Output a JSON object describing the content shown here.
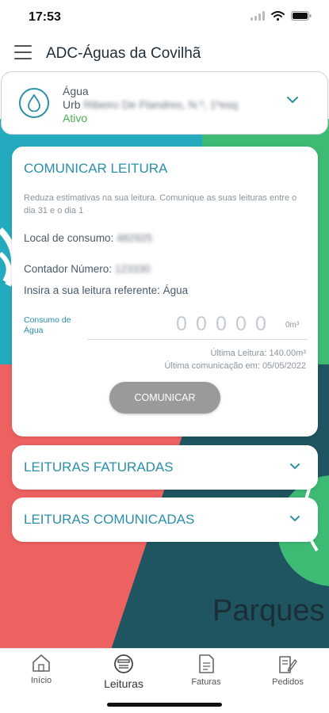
{
  "status_bar": {
    "time": "17:53"
  },
  "header": {
    "title": "ADC-Águas da Covilhã"
  },
  "contract": {
    "type": "Água",
    "address_prefix": "Urb",
    "address_redacted": "Ribeiro De Flandres, N.º, 1ºesq",
    "status": "Ativo",
    "icon": "water-drop-icon"
  },
  "reading_card": {
    "title": "COMUNICAR LEITURA",
    "note": "Reduza estimativas na sua leitura. Comunique as suas leituras entre o dia 31 e o dia 1",
    "local_label": "Local de consumo:",
    "local_value": "482925",
    "meter_label": "Contador Número:",
    "meter_value": "123330",
    "insert_label": "Insira a sua leitura referente:",
    "insert_value": "Água",
    "consumption_label": "Consumo de Água",
    "digits": [
      "0",
      "0",
      "0",
      "0",
      "0"
    ],
    "unit": "0m³",
    "last_reading": "Última Leitura: 140.00m³",
    "last_communication": "Última comunicação em: 05/05/2022",
    "button": "COMUNICAR"
  },
  "accordions": [
    {
      "label": "LEITURAS FATURADAS"
    },
    {
      "label": "LEITURAS COMUNICADAS"
    }
  ],
  "background": {
    "left_text": "o",
    "right_text": "Parques",
    "colors": {
      "teal": "#24aabf",
      "green": "#3dba74",
      "coral": "#ee6161",
      "dark": "#1f5560"
    }
  },
  "tabs": [
    {
      "label": "Início",
      "icon": "home-icon"
    },
    {
      "label": "Leituras",
      "icon": "meter-icon"
    },
    {
      "label": "Faturas",
      "icon": "invoice-icon"
    },
    {
      "label": "Pedidos",
      "icon": "requests-icon"
    }
  ],
  "colors": {
    "accent": "#2a8fa8",
    "active_status": "#4caf50",
    "button_disabled": "#9a9a9a"
  }
}
